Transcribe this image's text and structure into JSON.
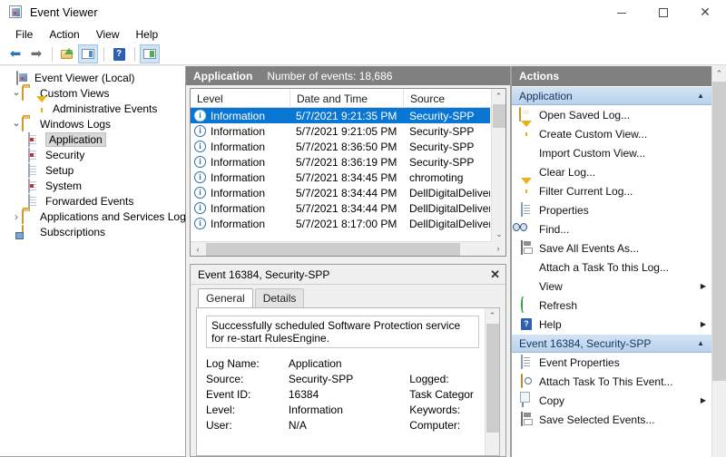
{
  "window": {
    "title": "Event Viewer",
    "icon": "event-viewer-icon",
    "minimize_label": "Minimize",
    "maximize_label": "Maximize",
    "close_label": "Close"
  },
  "menubar": {
    "items": [
      {
        "label": "File"
      },
      {
        "label": "Action"
      },
      {
        "label": "View"
      },
      {
        "label": "Help"
      }
    ]
  },
  "toolbar": {
    "buttons": [
      {
        "name": "back-icon",
        "label": "Back"
      },
      {
        "name": "forward-icon",
        "label": "Forward"
      },
      {
        "name": "open-folder-icon",
        "label": "Show/Hide Console Tree"
      },
      {
        "name": "show-action-pane-icon",
        "label": "Show/Hide Action Pane"
      },
      {
        "name": "help-icon",
        "label": "Help"
      },
      {
        "name": "properties-icon",
        "label": "Properties"
      }
    ]
  },
  "tree": {
    "items": [
      {
        "label": "Event Viewer (Local)",
        "indent": 0,
        "twisty": "none",
        "icon": "event-viewer-icon",
        "selected": false
      },
      {
        "label": "Custom Views",
        "indent": 1,
        "twisty": "open",
        "icon": "folder-icon",
        "selected": false
      },
      {
        "label": "Administrative Events",
        "indent": 2,
        "twisty": "none",
        "icon": "funnel-icon",
        "selected": false
      },
      {
        "label": "Windows Logs",
        "indent": 1,
        "twisty": "open",
        "icon": "folder-icon",
        "selected": false
      },
      {
        "label": "Application",
        "indent": 2,
        "twisty": "none",
        "icon": "log-red-icon",
        "selected": true
      },
      {
        "label": "Security",
        "indent": 2,
        "twisty": "none",
        "icon": "log-red-icon",
        "selected": false
      },
      {
        "label": "Setup",
        "indent": 2,
        "twisty": "none",
        "icon": "log-icon",
        "selected": false
      },
      {
        "label": "System",
        "indent": 2,
        "twisty": "none",
        "icon": "log-red-icon",
        "selected": false
      },
      {
        "label": "Forwarded Events",
        "indent": 2,
        "twisty": "none",
        "icon": "log-icon",
        "selected": false
      },
      {
        "label": "Applications and Services Logs",
        "indent": 1,
        "twisty": "closed",
        "icon": "folder-icon",
        "selected": false
      },
      {
        "label": "Subscriptions",
        "indent": 1,
        "twisty": "none",
        "icon": "subscriptions-icon",
        "selected": false
      }
    ]
  },
  "list": {
    "header_title": "Application",
    "header_count": "Number of events: 18,686",
    "columns": [
      "Level",
      "Date and Time",
      "Source"
    ],
    "rows": [
      {
        "level": "Information",
        "date": "5/7/2021 9:21:35 PM",
        "source": "Security-SPP",
        "selected": true
      },
      {
        "level": "Information",
        "date": "5/7/2021 9:21:05 PM",
        "source": "Security-SPP",
        "selected": false
      },
      {
        "level": "Information",
        "date": "5/7/2021 8:36:50 PM",
        "source": "Security-SPP",
        "selected": false
      },
      {
        "level": "Information",
        "date": "5/7/2021 8:36:19 PM",
        "source": "Security-SPP",
        "selected": false
      },
      {
        "level": "Information",
        "date": "5/7/2021 8:34:45 PM",
        "source": "chromoting",
        "selected": false
      },
      {
        "level": "Information",
        "date": "5/7/2021 8:34:44 PM",
        "source": "DellDigitalDelivery",
        "selected": false
      },
      {
        "level": "Information",
        "date": "5/7/2021 8:34:44 PM",
        "source": "DellDigitalDelivery",
        "selected": false
      },
      {
        "level": "Information",
        "date": "5/7/2021 8:17:00 PM",
        "source": "DellDigitalDelivery",
        "selected": false
      }
    ]
  },
  "detail": {
    "title": "Event 16384, Security-SPP",
    "close_label": "✕",
    "tabs": [
      {
        "label": "General",
        "active": true
      },
      {
        "label": "Details",
        "active": false
      }
    ],
    "message": "Successfully scheduled Software Protection service for re-start RulesEngine.",
    "fields": [
      {
        "label": "Log Name:",
        "value": "Application",
        "label2": "",
        "value2": ""
      },
      {
        "label": "Source:",
        "value": "Security-SPP",
        "label2": "Logged:",
        "value2": ""
      },
      {
        "label": "Event ID:",
        "value": "16384",
        "label2": "Task Categor",
        "value2": ""
      },
      {
        "label": "Level:",
        "value": "Information",
        "label2": "Keywords:",
        "value2": ""
      },
      {
        "label": "User:",
        "value": "N/A",
        "label2": "Computer:",
        "value2": ""
      }
    ]
  },
  "actions": {
    "header": "Actions",
    "sections": [
      {
        "title": "Application",
        "collapse_glyph": "▲",
        "items": [
          {
            "label": "Open Saved Log...",
            "icon": "open-saved-log-icon",
            "submenu": false
          },
          {
            "label": "Create Custom View...",
            "icon": "funnel-icon",
            "submenu": false
          },
          {
            "label": "Import Custom View...",
            "icon": "none",
            "submenu": false
          },
          {
            "label": "Clear Log...",
            "icon": "none",
            "submenu": false
          },
          {
            "label": "Filter Current Log...",
            "icon": "funnel-icon",
            "submenu": false
          },
          {
            "label": "Properties",
            "icon": "properties-icon",
            "submenu": false
          },
          {
            "label": "Find...",
            "icon": "binoculars-icon",
            "submenu": false
          },
          {
            "label": "Save All Events As...",
            "icon": "save-icon",
            "submenu": false
          },
          {
            "label": "Attach a Task To this Log...",
            "icon": "none",
            "submenu": false
          },
          {
            "label": "View",
            "icon": "none",
            "submenu": true
          },
          {
            "label": "Refresh",
            "icon": "refresh-icon",
            "submenu": false
          },
          {
            "label": "Help",
            "icon": "help-icon",
            "submenu": true
          }
        ]
      },
      {
        "title": "Event 16384, Security-SPP",
        "collapse_glyph": "▲",
        "items": [
          {
            "label": "Event Properties",
            "icon": "event-properties-icon",
            "submenu": false
          },
          {
            "label": "Attach Task To This Event...",
            "icon": "attach-task-icon",
            "submenu": false
          },
          {
            "label": "Copy",
            "icon": "copy-icon",
            "submenu": true
          },
          {
            "label": "Save Selected Events...",
            "icon": "save-icon",
            "submenu": false
          }
        ]
      }
    ]
  },
  "colors": {
    "selection_blue": "#0a76d4",
    "pane_header_gray": "#808080",
    "section_blue": "#bdd6ee",
    "window_bg": "#f0f0f0"
  }
}
